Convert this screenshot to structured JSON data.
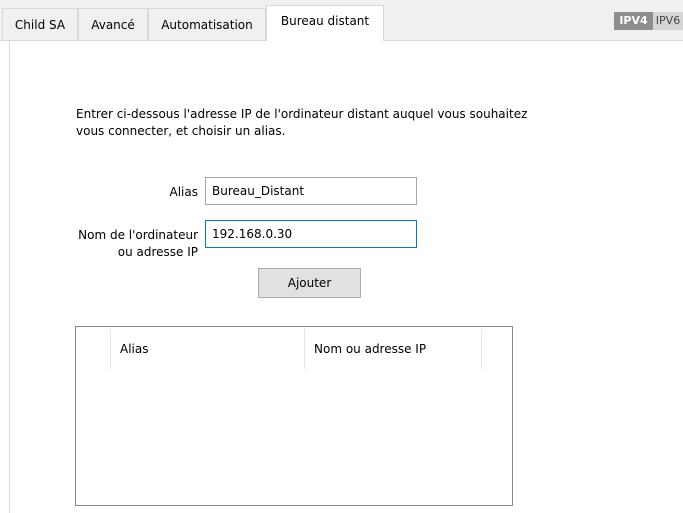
{
  "tabs": [
    {
      "label": "Child SA",
      "active": false
    },
    {
      "label": "Avancé",
      "active": false
    },
    {
      "label": "Automatisation",
      "active": false
    },
    {
      "label": "Bureau distant",
      "active": true
    }
  ],
  "ip_version": {
    "ipv4": "IPV4",
    "ipv6": "IPV6",
    "selected": "IPV4"
  },
  "description": "Entrer ci-dessous l'adresse IP de l'ordinateur distant auquel vous souhaitez vous connecter, et choisir un alias.",
  "form": {
    "alias_label": "Alias",
    "alias_value": "Bureau_Distant",
    "host_label_line1": "Nom de l'ordinateur",
    "host_label_line2": "ou adresse IP",
    "host_value": "192.168.0.30",
    "add_button": "Ajouter"
  },
  "list": {
    "columns": [
      "Alias",
      "Nom ou adresse IP"
    ],
    "rows": []
  },
  "colors": {
    "focus_border": "#0078d7",
    "ipv_selected_bg": "#8e8e8e"
  }
}
